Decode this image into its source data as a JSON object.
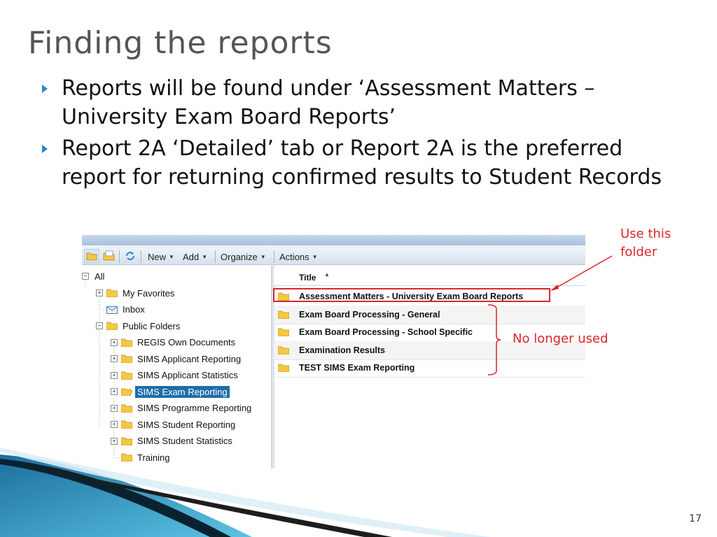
{
  "slide": {
    "title": "Finding the reports",
    "bullets": [
      "Reports will be found under ‘Assessment Matters – University Exam Board Reports’",
      "Report 2A ‘Detailed’ tab or Report 2A is the preferred report for returning confirmed results to Student Records"
    ],
    "page_number": "17"
  },
  "annotations": {
    "use_folder": [
      "Use this",
      "folder"
    ],
    "no_longer_used": "No longer used",
    "color": "#d9262a"
  },
  "toolbar": {
    "new_label": "New",
    "add_label": "Add",
    "organize_label": "Organize",
    "actions_label": "Actions"
  },
  "tree": {
    "root": "All",
    "items": [
      {
        "label": "My Favorites",
        "expander": "+"
      },
      {
        "label": "Inbox",
        "expander": ""
      },
      {
        "label": "Public Folders",
        "expander": "−"
      },
      {
        "label": "REGIS Own Documents",
        "expander": "+"
      },
      {
        "label": "SIMS Applicant Reporting",
        "expander": "+"
      },
      {
        "label": "SIMS Applicant Statistics",
        "expander": "+"
      },
      {
        "label": "SIMS Exam Reporting",
        "expander": "+",
        "selected": true
      },
      {
        "label": "SIMS Programme Reporting",
        "expander": "+"
      },
      {
        "label": "SIMS Student Reporting",
        "expander": "+"
      },
      {
        "label": "SIMS Student Statistics",
        "expander": "+"
      },
      {
        "label": "Training",
        "expander": ""
      }
    ]
  },
  "list": {
    "column_title": "Title",
    "rows": [
      "Assessment Matters - University Exam Board Reports",
      "Exam Board Processing - General",
      "Exam Board Processing - School Specific",
      "Examination Results",
      "TEST SIMS Exam Reporting"
    ]
  },
  "colors": {
    "accent_blue": "#2a86c8",
    "selection": "#1e6ea8",
    "folder_yellow": "#f5c842"
  }
}
